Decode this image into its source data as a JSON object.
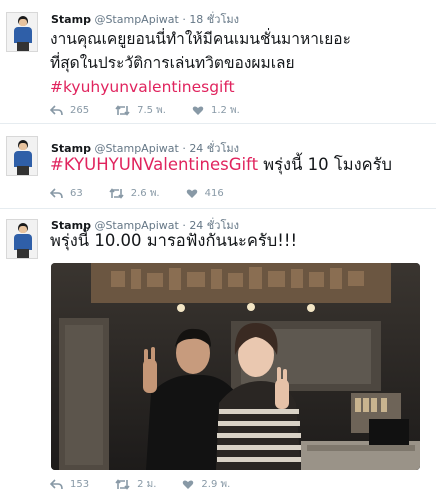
{
  "tweets": [
    {
      "name": "Stamp",
      "handle": "@StampApiwat",
      "dot": "·",
      "time": "18 ชั่วโมง",
      "text_lines": [
        "งานคุณเคยูยอนนี่ทำให้มีคนเมนชั่นมาหาเยอะ",
        "ที่สุดในประวัติการเล่นทวิตของผมเลย"
      ],
      "hashtag": "#kyuhyunvalentinesgift",
      "replies": "265",
      "retweets": "7.5 พ.",
      "likes": "1.2 พ."
    },
    {
      "name": "Stamp",
      "handle": "@StampApiwat",
      "dot": "·",
      "time": "24 ชั่วโมง",
      "hashtag": "#KYUHYUNValentinesGift",
      "text_after": " พรุ่งนี้ 10 โมงครับ",
      "replies": "63",
      "retweets": "2.6 พ.",
      "likes": "416"
    },
    {
      "name": "Stamp",
      "handle": "@StampApiwat",
      "dot": "·",
      "time": "24 ชั่วโมง",
      "text": "พรุ่งนี้ 10.00 มารอฟังกันนะครับ!!!",
      "replies": "153",
      "retweets": "2 ม.",
      "likes": "2.9 พ."
    }
  ],
  "colors": {
    "hashtag": "#e0245e",
    "icon": "#8899a6",
    "divider": "#e6ecf0"
  },
  "icons": [
    "avatar-image",
    "reply-icon",
    "retweet-icon",
    "like-icon"
  ]
}
